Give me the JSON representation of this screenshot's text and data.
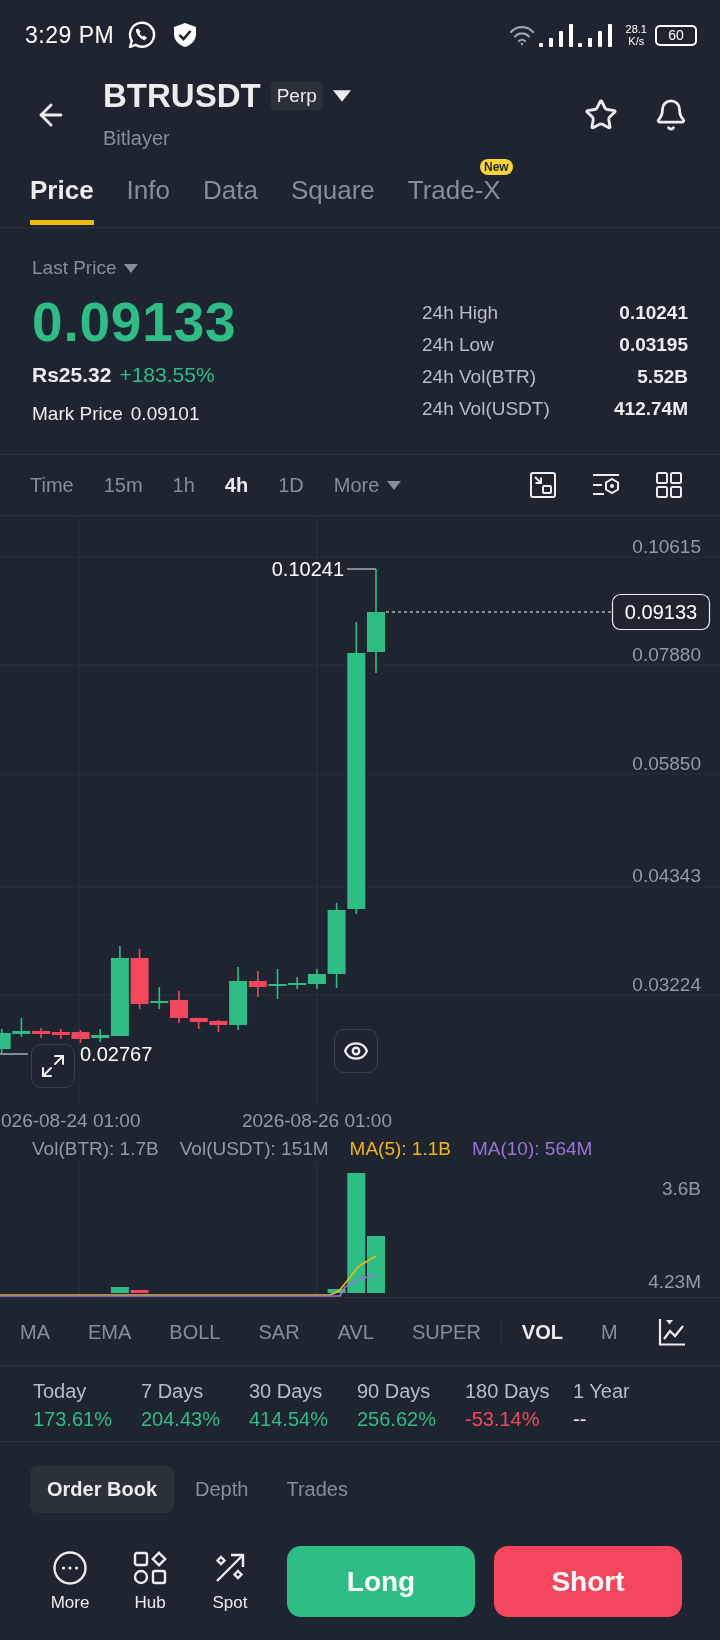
{
  "status_bar": {
    "time": "3:29 PM",
    "speed": "28.1",
    "speed_unit": "K/s",
    "battery": "60"
  },
  "header": {
    "symbol": "BTRUSDT",
    "badge": "Perp",
    "name": "Bitlayer",
    "favorite": false
  },
  "tabs": [
    {
      "label": "Price",
      "selected": true
    },
    {
      "label": "Info",
      "selected": false
    },
    {
      "label": "Data",
      "selected": false
    },
    {
      "label": "Square",
      "selected": false
    },
    {
      "label": "Trade-X",
      "selected": false,
      "badge": "New"
    }
  ],
  "price": {
    "selector": "Last Price",
    "last": "0.09133",
    "local": "Rs25.32",
    "change": "+183.55%",
    "mark_label": "Mark Price",
    "mark": "0.09101"
  },
  "stats": [
    {
      "label": "24h High",
      "value": "0.10241"
    },
    {
      "label": "24h Low",
      "value": "0.03195"
    },
    {
      "label": "24h Vol(BTR)",
      "value": "5.52B"
    },
    {
      "label": "24h Vol(USDT)",
      "value": "412.74M"
    }
  ],
  "intervals": [
    {
      "label": "Time",
      "kind": "interval",
      "selected": false
    },
    {
      "label": "15m",
      "kind": "interval",
      "selected": false
    },
    {
      "label": "1h",
      "kind": "interval",
      "selected": false
    },
    {
      "label": "4h",
      "kind": "interval",
      "selected": true
    },
    {
      "label": "1D",
      "kind": "interval",
      "selected": false
    },
    {
      "label": "More",
      "kind": "menu",
      "selected": false
    }
  ],
  "chart": {
    "price_axis": [
      "0.10615",
      "0.07880",
      "0.05850",
      "0.04343",
      "0.03224"
    ],
    "last_price": "0.09133",
    "high_label": "0.10241",
    "low_label": "0.02767",
    "time_axis": [
      "026-08-24 01:00",
      "2026-08-26 01:00"
    ]
  },
  "volume": {
    "legend": [
      {
        "label": "Vol(BTR): 1.7B",
        "color": "#929aa5"
      },
      {
        "label": "Vol(USDT): 151M",
        "color": "#929aa5"
      },
      {
        "label": "MA(5): 1.1B",
        "color": "#f0b90b"
      },
      {
        "label": "MA(10): 564M",
        "color": "#9a74d6"
      }
    ],
    "axis": [
      "3.6B",
      "4.23M"
    ]
  },
  "main_indicators": [
    {
      "label": "MA",
      "selected": false
    },
    {
      "label": "EMA",
      "selected": false
    },
    {
      "label": "BOLL",
      "selected": false
    },
    {
      "label": "SAR",
      "selected": false
    },
    {
      "label": "AVL",
      "selected": false
    },
    {
      "label": "SUPER",
      "selected": false
    }
  ],
  "sub_indicators": [
    {
      "label": "VOL",
      "selected": true
    },
    {
      "label": "M",
      "selected": false
    }
  ],
  "performance": [
    {
      "period": "Today",
      "value": "173.61%",
      "color": "#2ebd85"
    },
    {
      "period": "7 Days",
      "value": "204.43%",
      "color": "#2ebd85"
    },
    {
      "period": "30 Days",
      "value": "414.54%",
      "color": "#2ebd85"
    },
    {
      "period": "90 Days",
      "value": "256.62%",
      "color": "#2ebd85"
    },
    {
      "period": "180 Days",
      "value": "-53.14%",
      "color": "#f6465d"
    },
    {
      "period": "1 Year",
      "value": "--",
      "color": "#eaecef"
    }
  ],
  "book_tabs": [
    {
      "label": "Order Book",
      "selected": true
    },
    {
      "label": "Depth",
      "selected": false
    },
    {
      "label": "Trades",
      "selected": false
    }
  ],
  "actions": [
    {
      "label": "More",
      "kind": "more"
    },
    {
      "label": "Hub",
      "kind": "hub"
    },
    {
      "label": "Spot",
      "kind": "spot"
    }
  ],
  "trade_buttons": [
    {
      "label": "Long",
      "color": "#2ebd85"
    },
    {
      "label": "Short",
      "color": "#f6465d"
    }
  ]
}
